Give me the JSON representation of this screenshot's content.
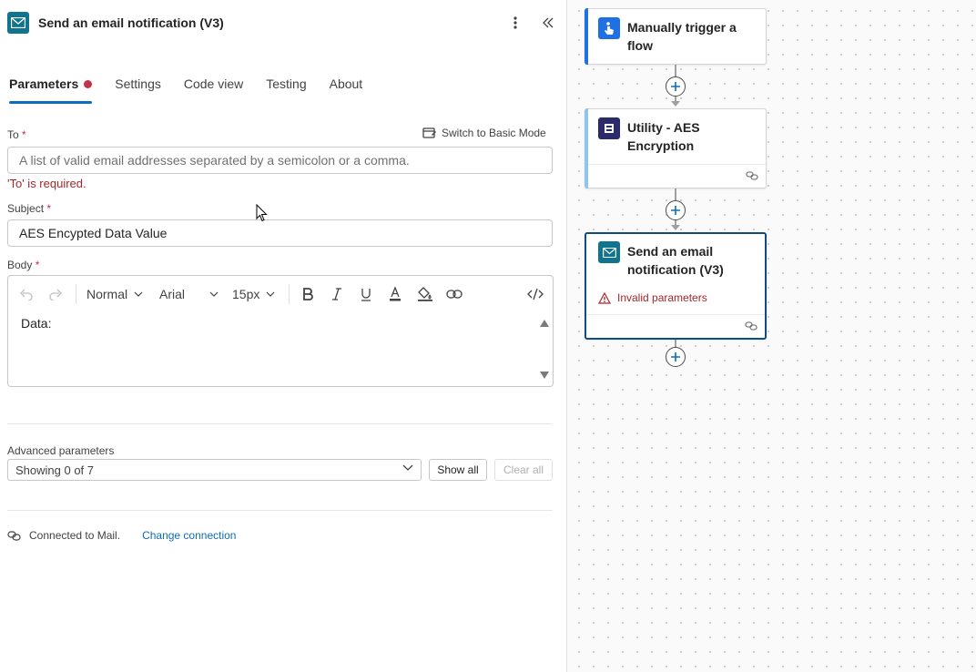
{
  "panel": {
    "title": "Send an email notification (V3)",
    "tabs": [
      {
        "label": "Parameters"
      },
      {
        "label": "Settings"
      },
      {
        "label": "Code view"
      },
      {
        "label": "Testing"
      },
      {
        "label": "About"
      }
    ],
    "switch_mode_label": "Switch to Basic Mode",
    "to": {
      "label": "To",
      "required": "*",
      "placeholder": "A list of valid email addresses separated by a semicolon or a comma.",
      "error": "'To' is required."
    },
    "subject": {
      "label": "Subject",
      "required": "*",
      "value": "AES Encypted Data Value"
    },
    "body": {
      "label": "Body",
      "required": "*",
      "format": "Normal",
      "font": "Arial",
      "size": "15px",
      "content": "Data:"
    },
    "advanced": {
      "label": "Advanced parameters",
      "selected": "Showing 0 of 7",
      "show_all": "Show all",
      "clear_all": "Clear all"
    },
    "connection": {
      "status": "Connected to Mail.",
      "change_link": "Change connection"
    }
  },
  "canvas": {
    "nodes": [
      {
        "title": "Manually trigger a flow"
      },
      {
        "title": "Utility - AES Encryption"
      },
      {
        "title": "Send an email notification (V3)",
        "warning": "Invalid parameters"
      }
    ]
  },
  "colors": {
    "accent": "#0f6cbd",
    "error": "#a4262c",
    "mail_icon": "#10748f",
    "trigger_icon": "#1f6fe5",
    "selected_border": "#0f4c81"
  }
}
